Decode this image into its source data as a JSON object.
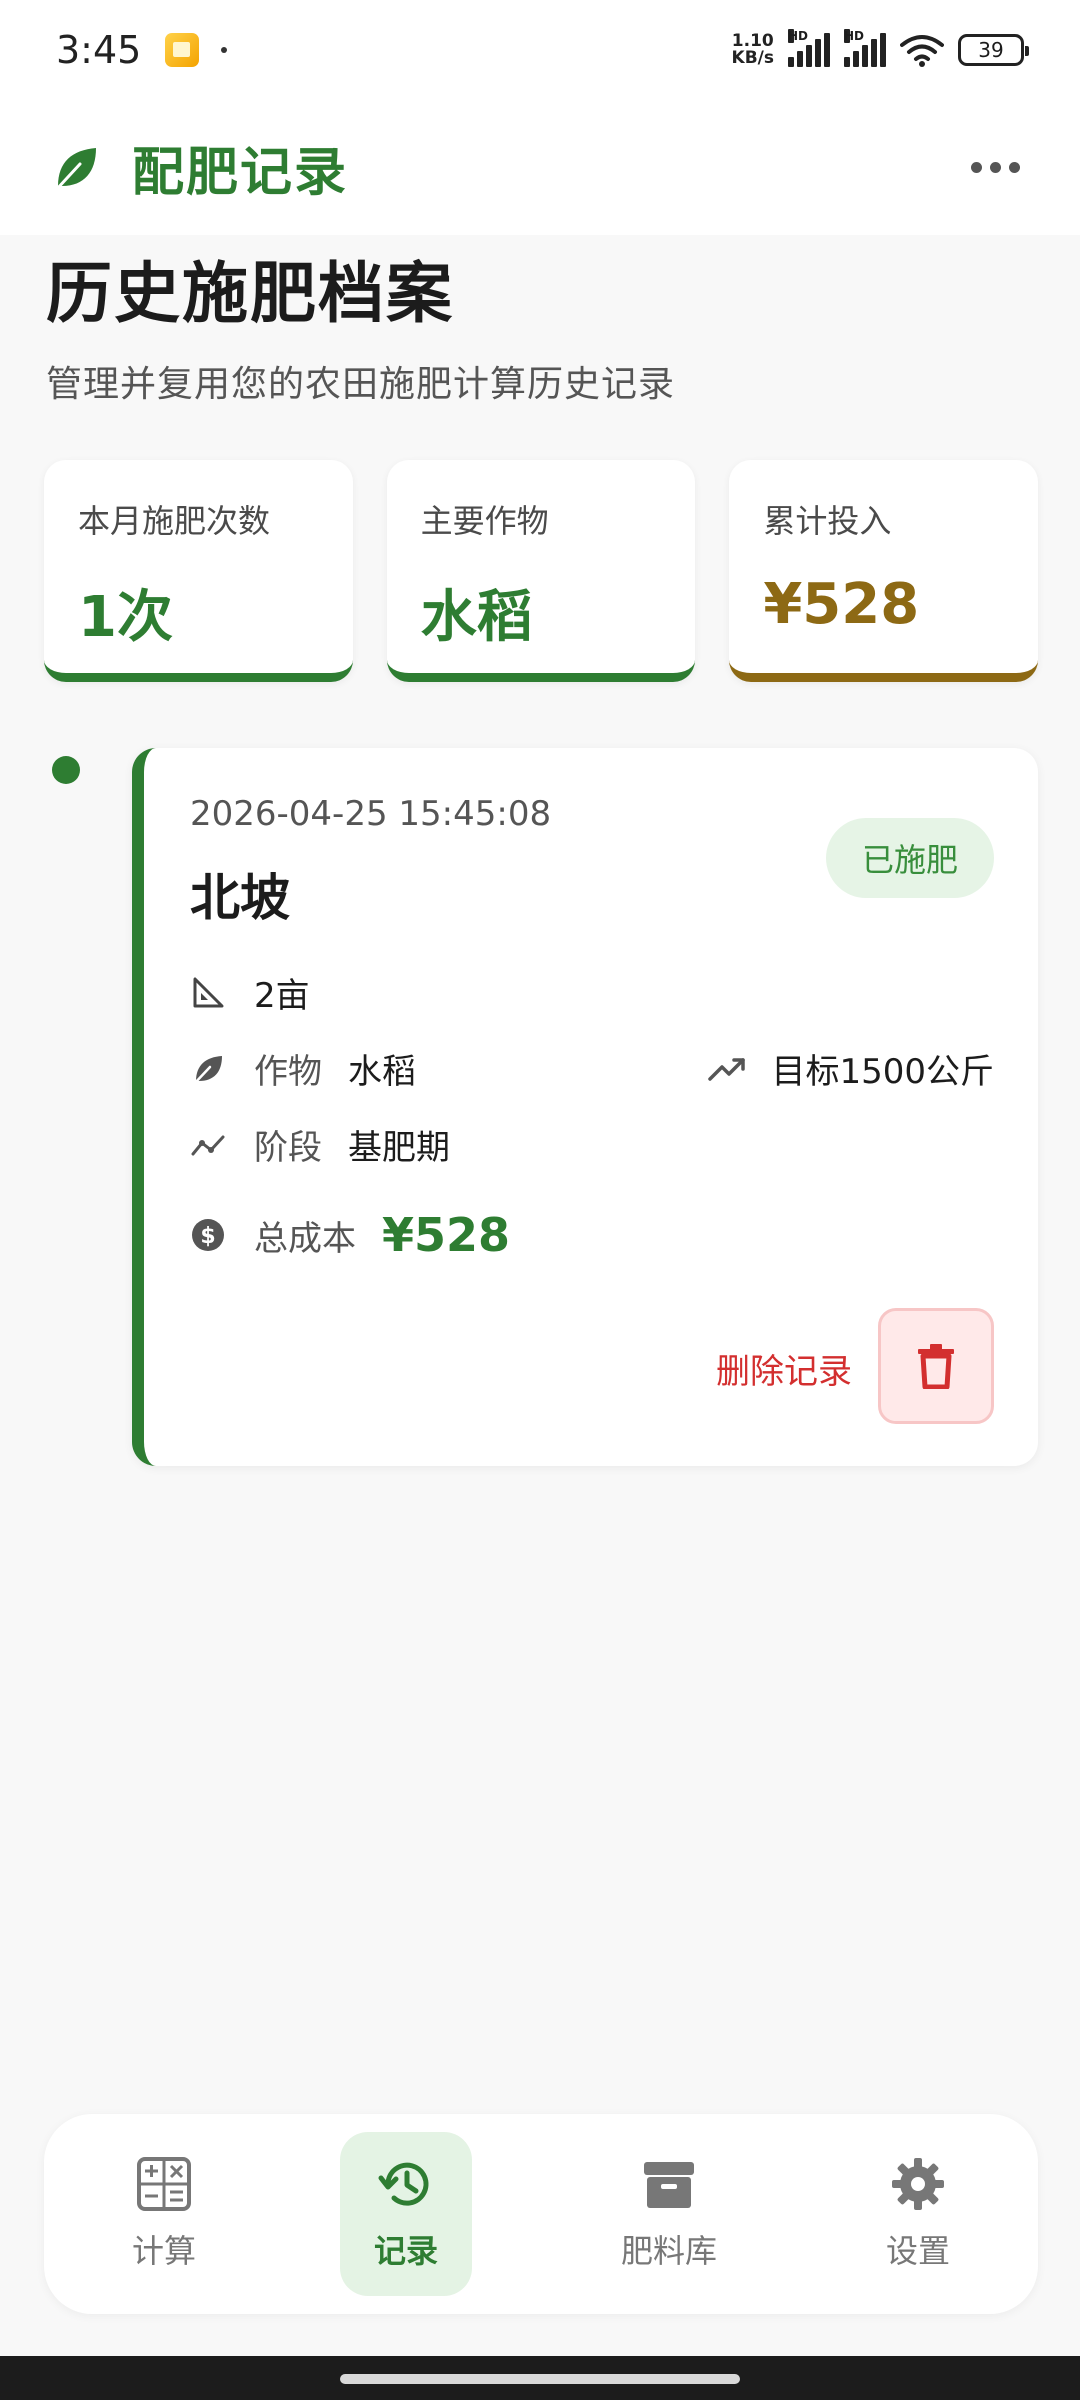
{
  "status_bar": {
    "time": "3:45",
    "net_speed_value": "1.10",
    "net_speed_unit": "KB/s",
    "signal_label_1": "HD",
    "signal_label_2": "HD",
    "battery": "39"
  },
  "app_bar": {
    "title": "配肥记录",
    "logo_icon": "leaf-icon",
    "menu_icon": "more-horizontal-icon"
  },
  "header": {
    "title": "历史施肥档案",
    "subtitle": "管理并复用您的农田施肥计算历史记录"
  },
  "stats": [
    {
      "label": "本月施肥次数",
      "value": "1次"
    },
    {
      "label": "主要作物",
      "value": "水稻"
    },
    {
      "label": "累计投入",
      "value": "¥528"
    }
  ],
  "record": {
    "date": "2026-04-25 15:45:08",
    "field": "北坡",
    "status": "已施肥",
    "area": "2亩",
    "crop_label": "作物",
    "crop": "水稻",
    "target": "目标1500公斤",
    "stage_label": "阶段",
    "stage": "基肥期",
    "cost_label": "总成本",
    "cost": "¥528",
    "delete_label": "删除记录"
  },
  "nav": [
    {
      "label": "计算",
      "icon": "calculator-icon",
      "active": false
    },
    {
      "label": "记录",
      "icon": "history-icon",
      "active": true
    },
    {
      "label": "肥料库",
      "icon": "archive-icon",
      "active": false
    },
    {
      "label": "设置",
      "icon": "gear-icon",
      "active": false
    }
  ],
  "colors": {
    "primary": "#2e7d32",
    "cost_accent": "#8d6914",
    "danger": "#d32f2f",
    "badge_bg": "#e6f4e6"
  }
}
